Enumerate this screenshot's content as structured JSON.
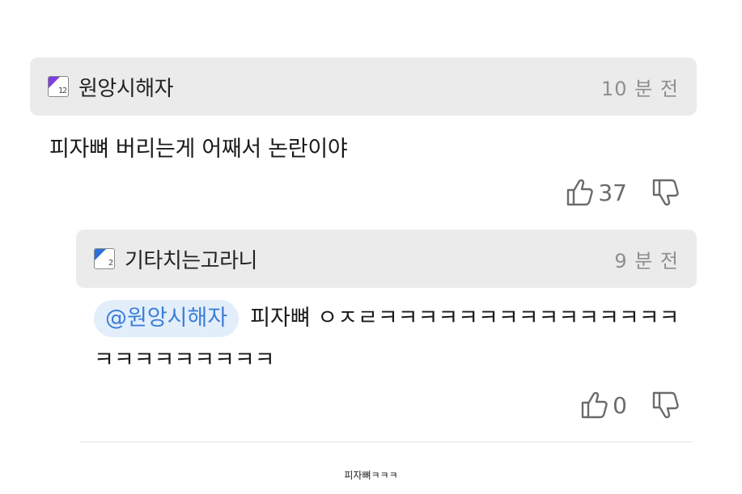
{
  "comments": [
    {
      "level": "12",
      "username": "원앙시해자",
      "time": "10 분 전",
      "text": "피자뼈 버리는게 어째서 논란이야",
      "likes": "37"
    }
  ],
  "reply": {
    "level": "2",
    "username": "기타치는고라니",
    "time": "9 분 전",
    "mention": "@원앙시해자",
    "text": "피자뼈 ㅇㅈㄹㅋㅋㅋㅋㅋㅋㅋㅋㅋㅋㅋㅋㅋㅋㅋㅋㅋㅋㅋㅋㅋㅋㅋㅋ",
    "likes": "0"
  },
  "caption": "피자뼈ㅋㅋㅋ",
  "colors": {
    "header_bg": "#ebebeb",
    "mention_bg": "#e3eefb",
    "mention_text": "#3a7ed8",
    "badge_purple": "#7b3fe4",
    "badge_blue": "#2d6fd6",
    "muted": "#8e8e8e"
  },
  "icons": {
    "like": "thumbs-up-icon",
    "dislike": "thumbs-down-icon",
    "level": "level-badge-icon"
  }
}
